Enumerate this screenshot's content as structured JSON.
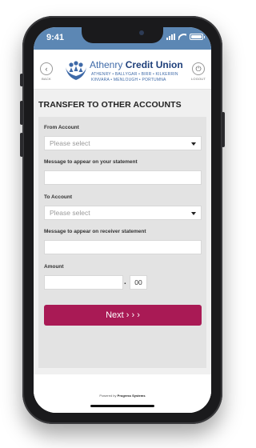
{
  "status": {
    "time": "9:41",
    "battery_level": 1.0
  },
  "header": {
    "back_label": "BACK",
    "logout_label": "LOGOUT",
    "logo_prefix": "Athenry",
    "logo_bold": "Credit Union",
    "logo_towns_1": "ATHENRY • BALLYGAR • BIRR • KILKERRIN",
    "logo_towns_2": "KINVARA • MENLOUGH • PORTUMNA"
  },
  "page": {
    "title": "TRANSFER TO OTHER ACCOUNTS"
  },
  "form": {
    "from_label": "From Account",
    "from_value": "Please select",
    "msg_self_label": "Message to appear on your statement",
    "msg_self_value": "",
    "to_label": "To Account",
    "to_value": "Please select",
    "msg_receiver_label": "Message to appear on receiver statement",
    "msg_receiver_value": "",
    "amount_label": "Amount",
    "amount_euros": "",
    "amount_separator": ".",
    "amount_cents": "00",
    "next_label": "Next › › ›"
  },
  "footer": {
    "powered_prefix": "Powered by",
    "powered_brand": "Progress Systems"
  },
  "colors": {
    "brand_blue": "#3f6aa8",
    "accent": "#a91a55",
    "status_bar": "#5c87b4"
  }
}
